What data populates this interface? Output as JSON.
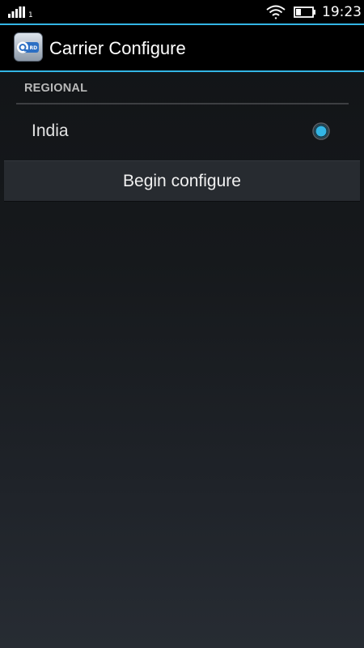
{
  "status_bar": {
    "sim_slot": "1",
    "time": "19:23",
    "icons": [
      "signal-icon",
      "wifi-icon",
      "battery-icon"
    ]
  },
  "action_bar": {
    "app_icon": "carrier-configure-app-icon",
    "title": "Carrier Configure"
  },
  "section": {
    "header": "REGIONAL",
    "items": [
      {
        "label": "India",
        "selected": true
      }
    ]
  },
  "button": {
    "label": "Begin configure"
  },
  "colors": {
    "accent": "#33b5e5",
    "radio_dot": "#33b5e5",
    "background_top": "#111316",
    "background_bottom": "#272c33",
    "button_bg": "#272b30"
  }
}
